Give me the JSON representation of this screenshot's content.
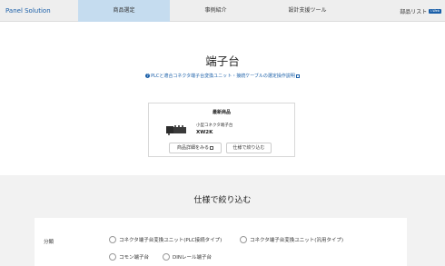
{
  "nav": {
    "brand": "Panel Solution",
    "tabs": [
      "商品選定",
      "事例紹介",
      "設計支援ツール"
    ],
    "last_tab": "部品リスト",
    "last_badge": "I-Web",
    "active_color": "#c5dcef"
  },
  "page": {
    "title": "端子台",
    "guide_link": "PLCと適合コネクタ端子台変換ユニット・接続ケーブルの選定操作説明"
  },
  "card": {
    "label": "最新商品",
    "product_type": "小型コネクタ端子台",
    "product_name": "XW2K",
    "detail_button": "商品詳細をみる",
    "filter_button": "仕様で絞り込む"
  },
  "filter": {
    "title": "仕様で絞り込む",
    "category_label": "分類",
    "options": [
      "コネクタ端子台変換ユニット(PLC接続タイプ)",
      "コネクタ端子台変換ユニット(汎用タイプ)",
      "コモン端子台",
      "DINレール端子台"
    ]
  },
  "colors": {
    "brand_blue": "#1a5fa8",
    "section_bg": "#f2f2f2"
  },
  "icons": [
    "question-circle-icon",
    "external-link-icon",
    "product-image"
  ]
}
